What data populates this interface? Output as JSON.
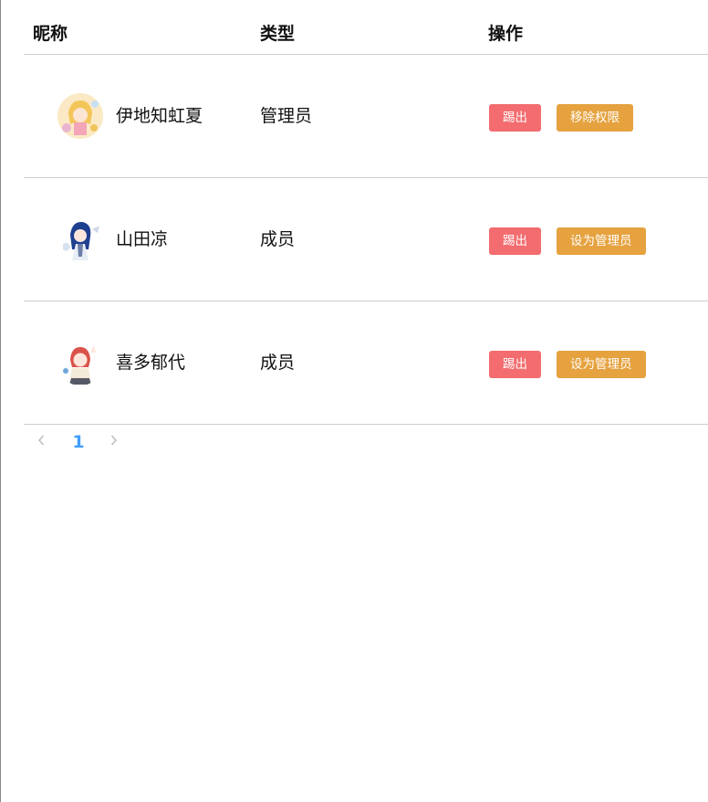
{
  "table": {
    "headers": {
      "nickname": "昵称",
      "type": "类型",
      "actions": "操作"
    },
    "rows": [
      {
        "avatar_icon": "anime-avatar-blonde",
        "nickname": "伊地知虹夏",
        "type": "管理员",
        "kick_label": "踢出",
        "perm_label": "移除权限"
      },
      {
        "avatar_icon": "anime-avatar-blue-hair",
        "nickname": "山田凉",
        "type": "成员",
        "kick_label": "踢出",
        "perm_label": "设为管理员"
      },
      {
        "avatar_icon": "anime-avatar-red-hair",
        "nickname": "喜多郁代",
        "type": "成员",
        "kick_label": "踢出",
        "perm_label": "设为管理员"
      }
    ]
  },
  "pagination": {
    "prev_icon": "chevron-left-icon",
    "current_page": "1",
    "next_icon": "chevron-right-icon"
  },
  "colors": {
    "kick_button": "#f36c6f",
    "perm_button": "#e5a23f",
    "active_page": "#409eff",
    "divider": "#cfcfcf"
  }
}
